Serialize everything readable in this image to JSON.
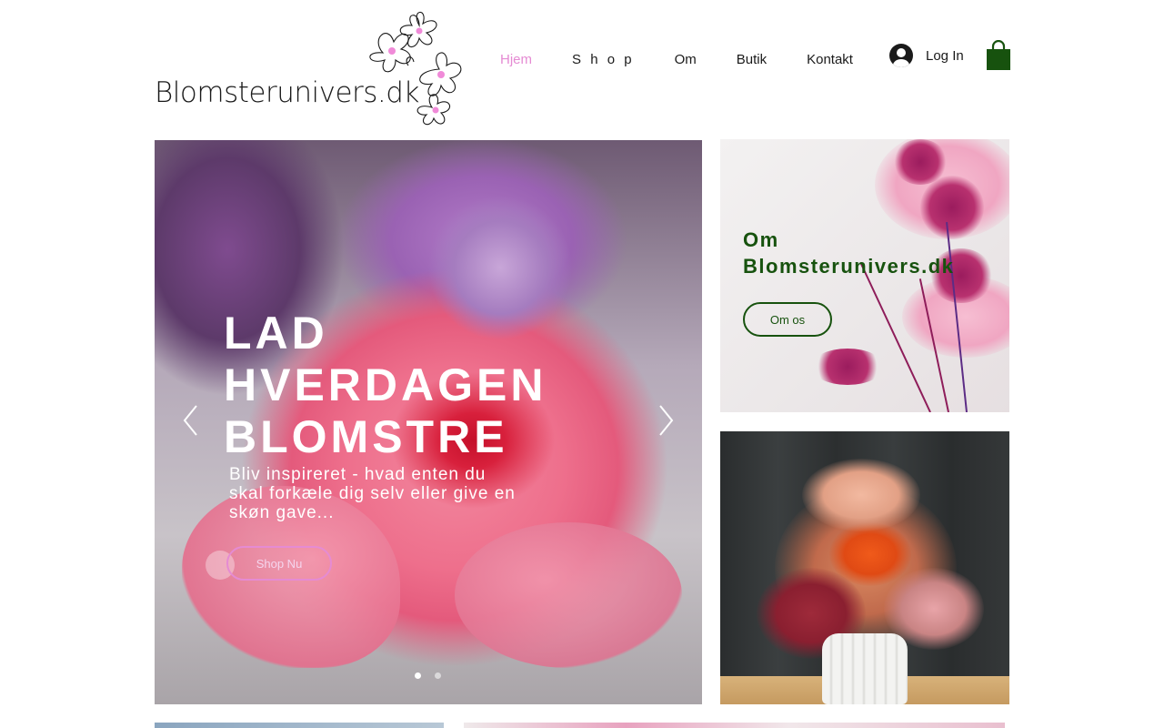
{
  "brand": {
    "logo_text": "Blomsterunivers.dk",
    "accent_color": "#e58bd3",
    "green_color": "#17520e"
  },
  "nav": {
    "items": [
      {
        "label": "Hjem",
        "active": true
      },
      {
        "label": "Shop",
        "active": false
      },
      {
        "label": "Om",
        "active": false
      },
      {
        "label": "Butik",
        "active": false
      },
      {
        "label": "Kontakt",
        "active": false
      }
    ]
  },
  "login": {
    "label": "Log In",
    "icon": "user-avatar-icon"
  },
  "cart": {
    "icon": "shopping-bag-icon"
  },
  "hero": {
    "title_lines": [
      "LAD",
      "HVERDAGEN",
      "BLOMSTRE"
    ],
    "subtitle": "Bliv inspireret - hvad enten du skal forkæle dig selv eller give en skøn gave...",
    "button_label": "Shop Nu",
    "prev_icon": "chevron-left-icon",
    "next_icon": "chevron-right-icon",
    "slide_count": 2,
    "active_slide": 1
  },
  "about": {
    "title_line1": "Om",
    "title_line2": "Blomsterunivers.dk",
    "button_label": "Om os"
  }
}
